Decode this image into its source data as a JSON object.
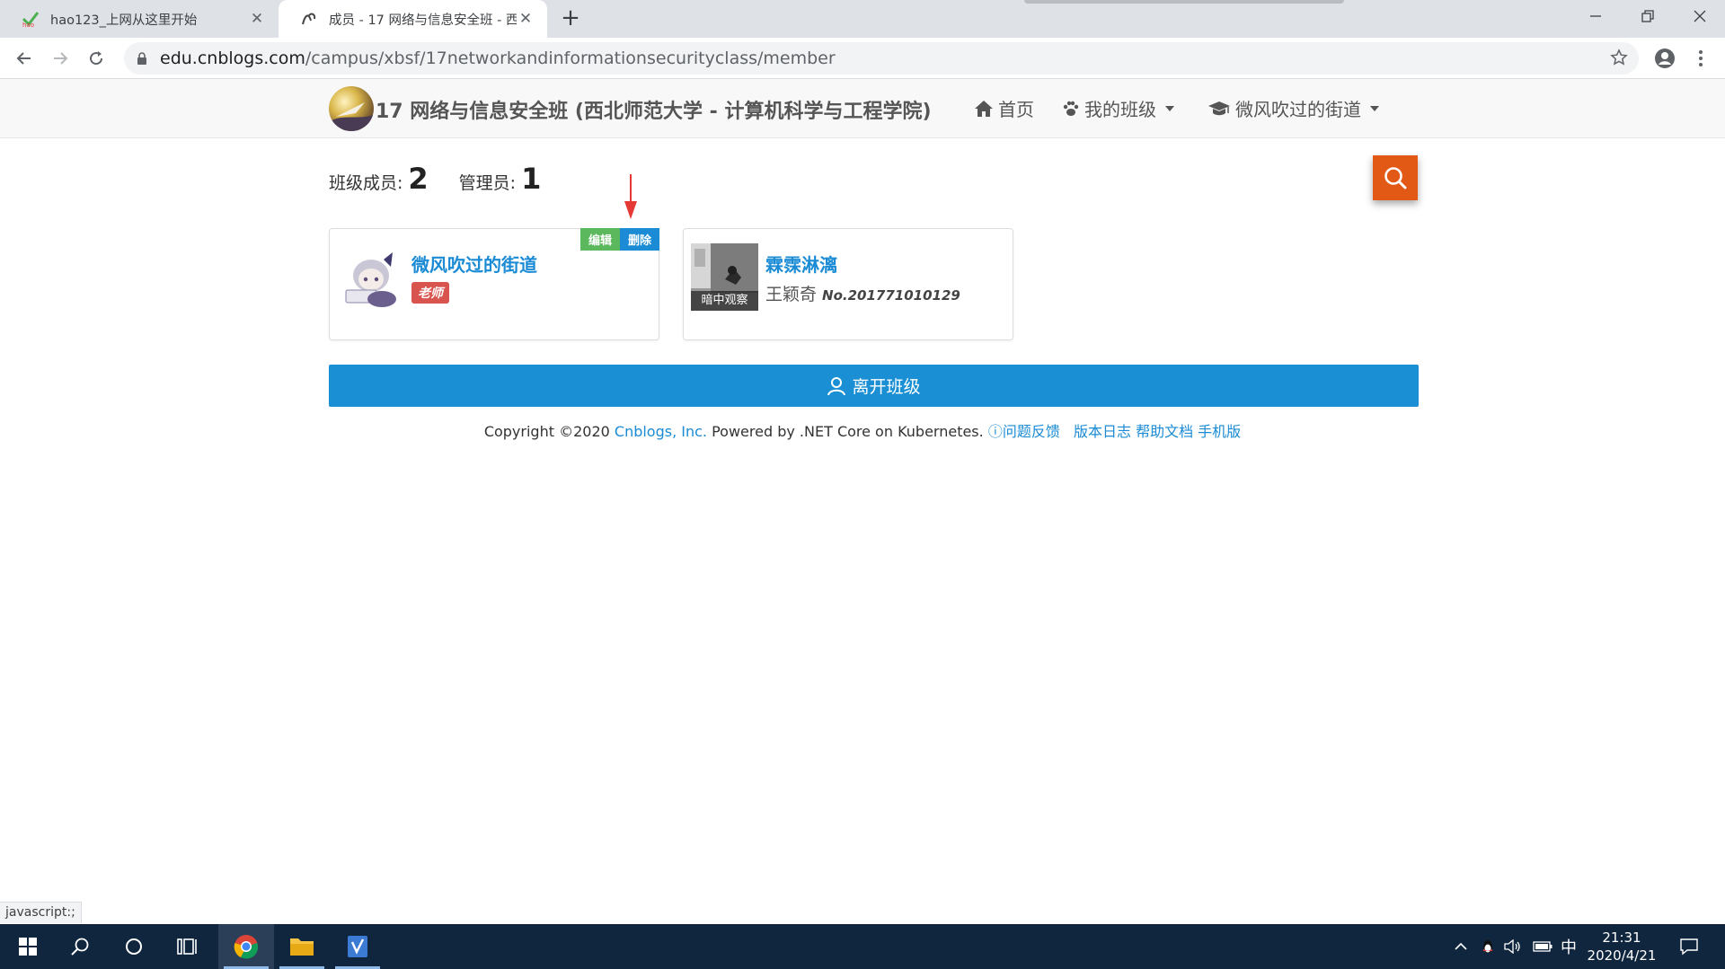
{
  "browser": {
    "tabs": [
      {
        "title": "hao123_上网从这里开始",
        "close": "✕"
      },
      {
        "title": "成员 - 17 网络与信息安全班 - 西",
        "close": "✕"
      }
    ],
    "new_tab": "+",
    "url_host": "edu.cnblogs.com",
    "url_path": "/campus/xbsf/17networkandinformationsecurityclass/member",
    "status_text": "javascript:;"
  },
  "site": {
    "title": "17 网络与信息安全班 (西北师范大学 - 计算机科学与工程学院)",
    "nav": {
      "home": "首页",
      "my_class": "我的班级",
      "user": "微风吹过的街道"
    }
  },
  "stats": {
    "members_label": "班级成员:",
    "members_count": "2",
    "admins_label": "管理员:",
    "admins_count": "1"
  },
  "members": [
    {
      "name": "微风吹过的街道",
      "role": "老师",
      "edit_label": "编辑",
      "delete_label": "删除"
    },
    {
      "name": "霖霂淋漓",
      "real_name": "王颖奇",
      "student_no": "No.201771010129",
      "avatar_caption": "暗中观察"
    }
  ],
  "leave_button": "离开班级",
  "footer": {
    "copyright": "Copyright ©2020",
    "company": "Cnblogs, Inc.",
    "powered": "Powered by .NET Core on Kubernetes.",
    "feedback": "问题反馈",
    "changelog": "版本日志",
    "help": "帮助文档",
    "mobile": "手机版"
  },
  "taskbar": {
    "ime": "中",
    "time": "21:31",
    "date": "2020/4/21"
  },
  "colors": {
    "accent_blue": "#1a8fd4",
    "search_orange": "#e15915",
    "teacher_badge": "#d9534f",
    "edit_green": "#5cb85c",
    "taskbar": "#10263e"
  }
}
